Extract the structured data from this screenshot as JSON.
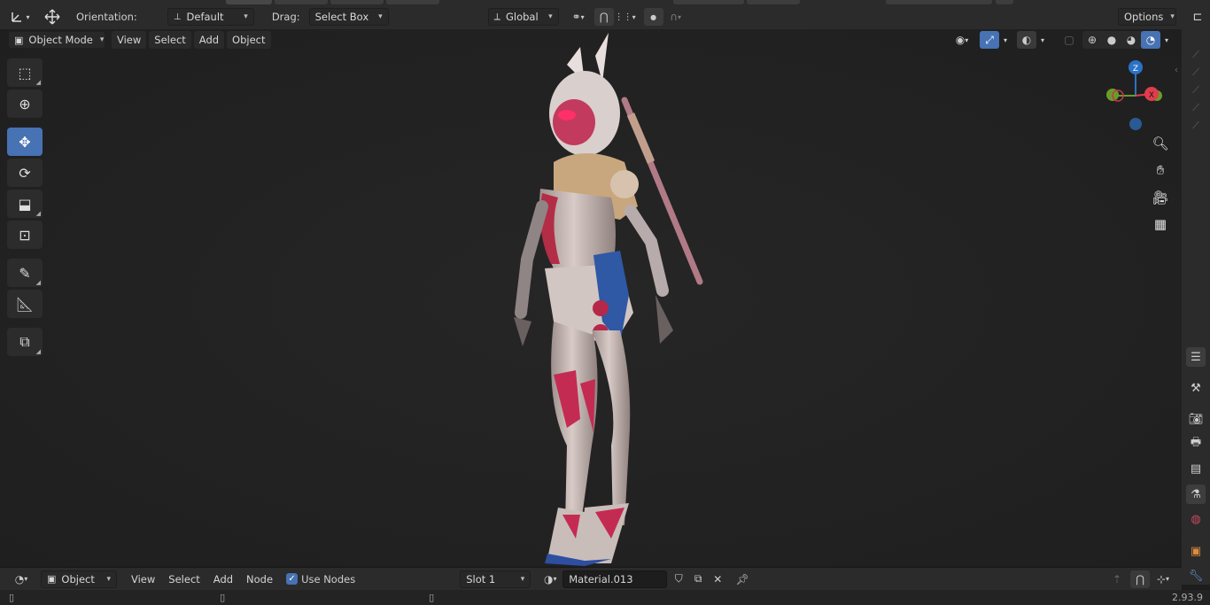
{
  "tool_header": {
    "orientation_label": "Orientation:",
    "orientation_value": "Default",
    "drag_label": "Drag:",
    "drag_value": "Select Box",
    "transform_orientation": "Global",
    "options_label": "Options"
  },
  "viewport_header": {
    "mode": "Object Mode",
    "menus": [
      "View",
      "Select",
      "Add",
      "Object"
    ]
  },
  "gizmo": {
    "z": "Z",
    "x": "X"
  },
  "shader_header": {
    "editor_mode": "Object",
    "menus": [
      "View",
      "Select",
      "Add",
      "Node"
    ],
    "use_nodes_label": "Use Nodes",
    "slot": "Slot 1",
    "material": "Material.013"
  },
  "status": {
    "version": "2.93.9"
  },
  "colors": {
    "accent": "#4772b3",
    "axis_x": "#e13c4d",
    "axis_y": "#6a9c2a",
    "axis_z": "#2a72c7"
  },
  "icons": {
    "tools": [
      "select-box-icon",
      "cursor-icon",
      "move-icon",
      "rotate-icon",
      "scale-icon",
      "transform-icon",
      "annotate-icon",
      "measure-icon",
      "add-cube-icon"
    ],
    "nav": [
      "zoom-icon",
      "pan-hand-icon",
      "camera-icon",
      "grid-view-icon"
    ]
  }
}
